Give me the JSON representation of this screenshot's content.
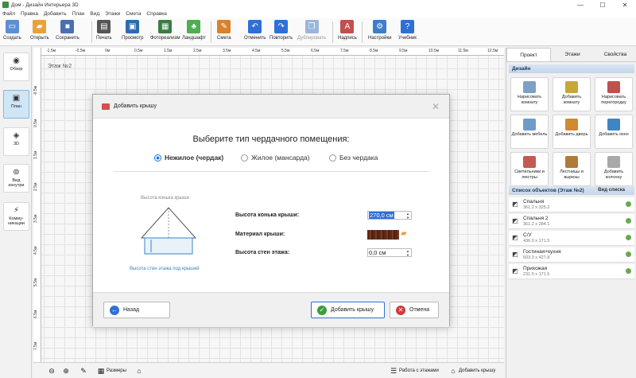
{
  "window": {
    "title": "Дом - Дизайн Интерьера 3D",
    "controls": [
      "—",
      "☐",
      "✕"
    ]
  },
  "menu": [
    "Файл",
    "Правка",
    "Добавить",
    "План",
    "Вид",
    "Этажи",
    "Смета",
    "Справка"
  ],
  "toolbar": [
    {
      "label": "Создать",
      "icon": "new-file-icon",
      "color": "#5b8fd6",
      "glyph": "▭"
    },
    {
      "label": "Открыть",
      "icon": "open-folder-icon",
      "color": "#e6a23c",
      "glyph": "▰"
    },
    {
      "label": "Сохранить",
      "icon": "save-icon",
      "color": "#4a6fb0",
      "glyph": "■"
    },
    {
      "label": "Печать",
      "icon": "print-icon",
      "color": "#555555",
      "glyph": "▤"
    },
    {
      "label": "Просмотр",
      "icon": "preview-monitor-icon",
      "color": "#2b6cb0",
      "glyph": "▣"
    },
    {
      "label": "Фотореализм",
      "icon": "photorealism-icon",
      "color": "#3a7d44",
      "glyph": "▦"
    },
    {
      "label": "Ландшафт",
      "icon": "landscape-icon",
      "color": "#4caf50",
      "glyph": "♣"
    },
    {
      "label": "Смета",
      "icon": "estimate-icon",
      "color": "#d9822b",
      "glyph": "✎"
    },
    {
      "label": "Отменить",
      "icon": "undo-icon",
      "color": "#2f6fd6",
      "glyph": "↶"
    },
    {
      "label": "Повторить",
      "icon": "redo-icon",
      "color": "#2f6fd6",
      "glyph": "↷"
    },
    {
      "label": "Дублировать",
      "icon": "duplicate-icon",
      "color": "#9ab6dd",
      "glyph": "❐",
      "disabled": true
    },
    {
      "label": "Надпись",
      "icon": "label-icon",
      "color": "#c0504d",
      "glyph": "A"
    },
    {
      "label": "Настройки",
      "icon": "settings-gear-icon",
      "color": "#3d7dca",
      "glyph": "⚙"
    },
    {
      "label": "Учебник",
      "icon": "help-icon",
      "color": "#2f6fd6",
      "glyph": "?"
    }
  ],
  "left_nav": [
    {
      "label": "Обзор",
      "icon": "eye-icon",
      "glyph": "◉"
    },
    {
      "label": "План",
      "icon": "plan-icon",
      "glyph": "▣",
      "active": true
    },
    {
      "label": "3D",
      "icon": "cube-3d-icon",
      "glyph": "◈"
    },
    {
      "label": "Вид изнутри",
      "icon": "inside-view-icon",
      "glyph": "⊚"
    },
    {
      "label": "Комму-никации",
      "icon": "communications-icon",
      "glyph": "⚡"
    }
  ],
  "ruler_h": [
    "-1.5м",
    "-0.5м",
    "0м",
    "0.5м",
    "1.5м",
    "2.5м",
    "3.5м",
    "4.5м",
    "5.5м",
    "6.5м",
    "7.5м",
    "8.5м",
    "9.5м",
    "10.5м",
    "11.5м",
    "12.5м"
  ],
  "ruler_v": [
    "-0.5м",
    "0.5м",
    "1.5м",
    "2.5м",
    "3.5м",
    "4.5м",
    "5.5м",
    "6.5м",
    "7.5м"
  ],
  "canvas": {
    "floor_label": "Этаж №2"
  },
  "bottombar": {
    "sizes": "Размеры",
    "floors_work": "Работа с этажами",
    "add_roof": "Добавить крышу"
  },
  "dialog": {
    "title": "Добавить крышу",
    "question": "Выберите тип чердачного помещения:",
    "radios": [
      {
        "label": "Нежилое (чердак)",
        "selected": true
      },
      {
        "label": "Жилое (мансарда)",
        "selected": false
      },
      {
        "label": "Без чердака",
        "selected": false
      }
    ],
    "diagram_top": "Высота конька крыши",
    "diagram_bottom": "Высота стен этажа под крышей",
    "fields": {
      "ridge_label": "Высота конька крыши:",
      "ridge_value": "270,0 см",
      "material_label": "Материал крыши:",
      "wall_label": "Высота стен этажа:",
      "wall_value": "0,0 см"
    },
    "back": "Назад",
    "add": "Добавить крышу",
    "cancel": "Отмена"
  },
  "right_panel": {
    "tabs": [
      "Проект",
      "Этажи",
      "Свойства"
    ],
    "design_header": "Дизайн",
    "design_buttons": [
      {
        "label": "Нарисовать комнату",
        "icon": "draw-room-icon",
        "color": "#7f9fc6"
      },
      {
        "label": "Добавить комнату",
        "icon": "add-room-icon",
        "color": "#c7a63a"
      },
      {
        "label": "Нарисовать перегородку",
        "icon": "draw-partition-icon",
        "color": "#c0504d"
      },
      {
        "label": "Добавить мебель",
        "icon": "add-furniture-icon",
        "color": "#6f9bc8"
      },
      {
        "label": "Добавить дверь",
        "icon": "add-door-icon",
        "color": "#d08a2f"
      },
      {
        "label": "Добавить окно",
        "icon": "add-window-icon",
        "color": "#3d86c6"
      },
      {
        "label": "Светильники и люстры",
        "icon": "lamps-icon",
        "color": "#c25b4f"
      },
      {
        "label": "Лестницы и вырезы",
        "icon": "stairs-icon",
        "color": "#b07b3a"
      },
      {
        "label": "Добавить колонну",
        "icon": "add-column-icon",
        "color": "#a8a8a8"
      }
    ],
    "objects_header": "Список объектов (Этаж №2)",
    "view_list": "Вид списка",
    "objects": [
      {
        "name": "Спальня",
        "size": "361.2 x 325.2"
      },
      {
        "name": "Спальня 2",
        "size": "361.2 x 284.1"
      },
      {
        "name": "С/У",
        "size": "436.0 x 171.5"
      },
      {
        "name": "Гостиная+кухня",
        "size": "603.3 x 427.8"
      },
      {
        "name": "Прихожая",
        "size": "231.5 x 171.5"
      }
    ]
  }
}
